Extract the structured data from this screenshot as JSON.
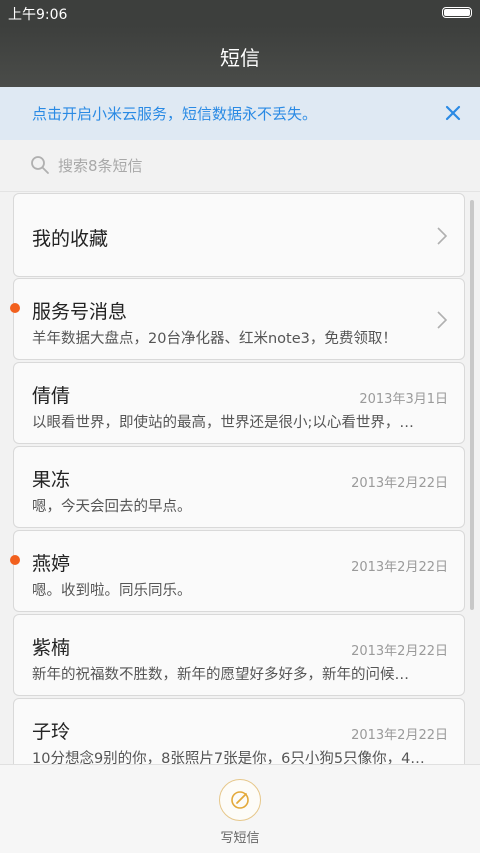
{
  "status": {
    "time": "上午9:06",
    "battery_level": 1.0
  },
  "header": {
    "title": "短信"
  },
  "banner": {
    "text": "点击开启小米云服务，短信数据永不丢失。"
  },
  "search": {
    "placeholder": "搜索8条短信"
  },
  "favorites": {
    "label": "我的收藏"
  },
  "service": {
    "name": "服务号消息",
    "snippet": "羊年数据大盘点，20台净化器、红米note3，免费领取！",
    "unread": true
  },
  "threads": [
    {
      "name": "倩倩",
      "date": "2013年3月1日",
      "snippet": "以眼看世界，即使站的最高，世界还是很小;以心看世界，…",
      "unread": false
    },
    {
      "name": "果冻",
      "date": "2013年2月22日",
      "snippet": "嗯，今天会回去的早点。",
      "unread": false
    },
    {
      "name": "燕婷",
      "date": "2013年2月22日",
      "snippet": "嗯。收到啦。同乐同乐。",
      "unread": true
    },
    {
      "name": "紫楠",
      "date": "2013年2月22日",
      "snippet": "新年的祝福数不胜数，新年的愿望好多好多，新年的问候…",
      "unread": false
    },
    {
      "name": "子玲",
      "date": "2013年2月22日",
      "snippet": "10分想念9别的你，8张照片7张是你，6只小狗5只像你，4…",
      "unread": false
    }
  ],
  "compose": {
    "label": "写短信"
  },
  "colors": {
    "accent": "#2a8ae4",
    "unread_dot": "#f2601e",
    "header_bg": "#3d3f3d"
  }
}
